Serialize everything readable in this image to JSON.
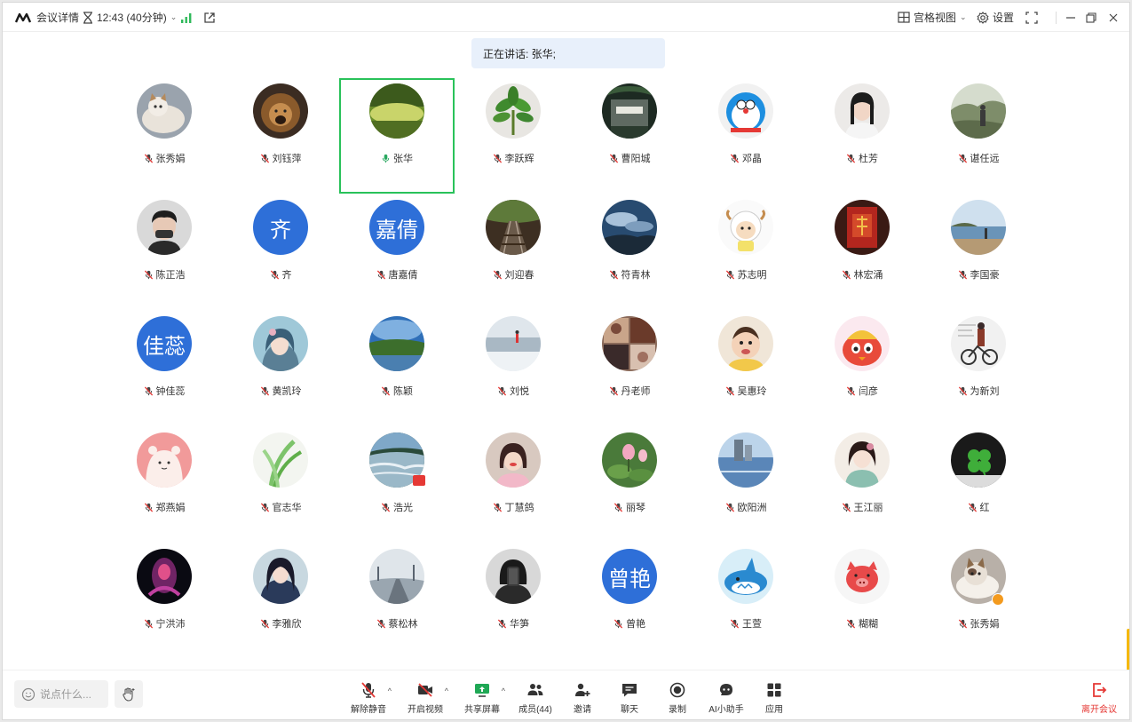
{
  "titlebar": {
    "meeting_details": "会议详情",
    "timer": "12:43 (40分钟)",
    "grid_view": "宫格视图",
    "settings": "设置"
  },
  "speaking_banner": "正在讲话: 张华;",
  "participants": [
    {
      "name": "张秀娟",
      "avatar": "cat-photo",
      "muted": true
    },
    {
      "name": "刘钰萍",
      "avatar": "lion-photo",
      "muted": true
    },
    {
      "name": "张华",
      "avatar": "lake-photo",
      "muted": false,
      "speaking": true
    },
    {
      "name": "李跃辉",
      "avatar": "plant-photo",
      "muted": true
    },
    {
      "name": "曹阳城",
      "avatar": "building-photo",
      "muted": true
    },
    {
      "name": "邓晶",
      "avatar": "doraemon-photo",
      "muted": true
    },
    {
      "name": "杜芳",
      "avatar": "portrait-photo",
      "muted": true
    },
    {
      "name": "谌任远",
      "avatar": "outdoor-photo",
      "muted": true
    },
    {
      "name": "陈正浩",
      "avatar": "boy-photo",
      "muted": true
    },
    {
      "name": "齐",
      "avatar_text": "齐",
      "muted": true
    },
    {
      "name": "唐嘉倩",
      "avatar_text": "嘉倩",
      "muted": true
    },
    {
      "name": "刘迎春",
      "avatar": "railway-photo",
      "muted": true
    },
    {
      "name": "符青林",
      "avatar": "sky-photo",
      "muted": true
    },
    {
      "name": "苏志明",
      "avatar": "sheep-cartoon",
      "muted": true
    },
    {
      "name": "林宏涌",
      "avatar": "red-door-photo",
      "muted": true
    },
    {
      "name": "李国豪",
      "avatar": "seaside-photo",
      "muted": true
    },
    {
      "name": "钟佳蕊",
      "avatar_text": "佳蕊",
      "muted": true
    },
    {
      "name": "黄凯玲",
      "avatar": "anime-girl",
      "muted": true
    },
    {
      "name": "陈颖",
      "avatar": "river-photo",
      "muted": true
    },
    {
      "name": "刘悦",
      "avatar": "beach-photo",
      "muted": true
    },
    {
      "name": "丹老师",
      "avatar": "collage-photo",
      "muted": true
    },
    {
      "name": "吴惠玲",
      "avatar": "baby-photo",
      "muted": true
    },
    {
      "name": "闫彦",
      "avatar": "chick-cartoon",
      "muted": true
    },
    {
      "name": "为新刘",
      "avatar": "bicycle-photo",
      "muted": true
    },
    {
      "name": "郑燕娟",
      "avatar": "bear-cartoon",
      "muted": true
    },
    {
      "name": "官志华",
      "avatar": "grass-photo",
      "muted": true
    },
    {
      "name": "浩光",
      "avatar": "stream-photo",
      "muted": true,
      "red_badge": true
    },
    {
      "name": "丁慧鸽",
      "avatar": "woman-photo",
      "muted": true
    },
    {
      "name": "丽琴",
      "avatar": "lotus-photo",
      "muted": true
    },
    {
      "name": "欧阳洲",
      "avatar": "blue-lake-photo",
      "muted": true
    },
    {
      "name": "王江丽",
      "avatar": "lady-drawing",
      "muted": true
    },
    {
      "name": "红",
      "avatar": "clover-photo",
      "muted": true
    },
    {
      "name": "宁洪沛",
      "avatar": "dark-figure",
      "muted": true
    },
    {
      "name": "李雅欣",
      "avatar": "girl-drawing",
      "muted": true
    },
    {
      "name": "蔡松林",
      "avatar": "road-photo",
      "muted": true
    },
    {
      "name": "华笋",
      "avatar": "selfie-photo",
      "muted": true
    },
    {
      "name": "曾艳",
      "avatar_text": "曾艳",
      "muted": true
    },
    {
      "name": "王萱",
      "avatar": "shark-cartoon",
      "muted": true
    },
    {
      "name": "糊糊",
      "avatar": "pig-cartoon",
      "muted": true
    },
    {
      "name": "张秀娟",
      "avatar": "cat-photo-2",
      "muted": true,
      "person_badge": true
    }
  ],
  "toolbar": {
    "chat_placeholder": "说点什么...",
    "unmute": "解除静音",
    "start_video": "开启视频",
    "share_screen": "共享屏幕",
    "members": "成员(44)",
    "invite": "邀请",
    "chat": "聊天",
    "record": "录制",
    "ai_assistant": "AI小助手",
    "apps": "应用",
    "leave": "离开会议"
  },
  "colors": {
    "accent": "#2e6fd8",
    "speaking_border": "#29c25a",
    "muted_red": "#e53935",
    "banner_bg": "#e8f0fb"
  }
}
